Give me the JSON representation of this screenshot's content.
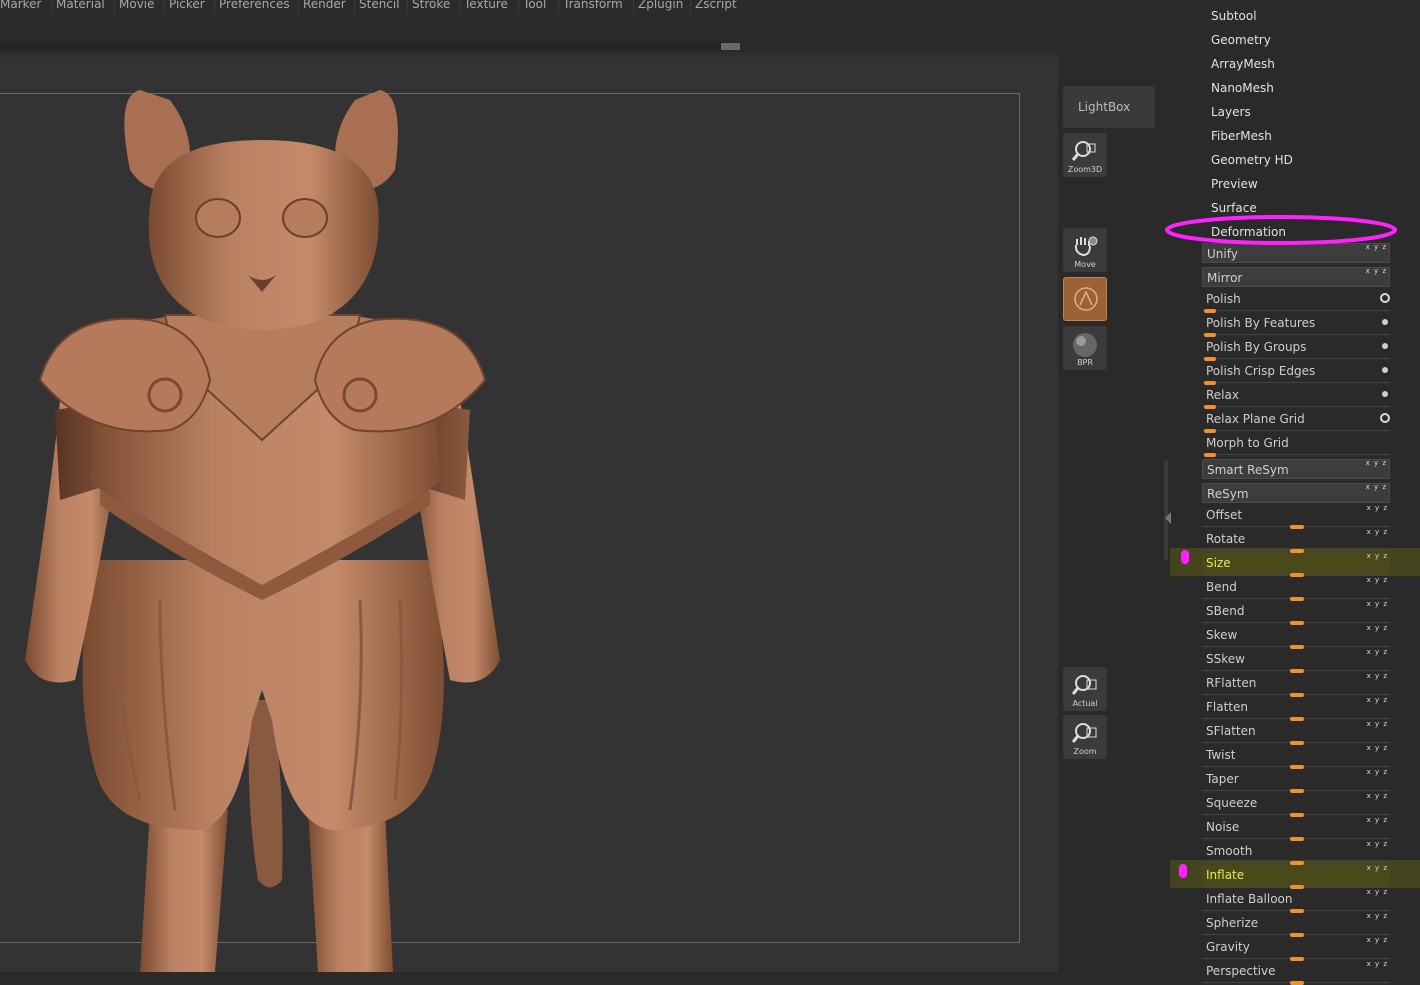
{
  "menu": [
    "Marker",
    "Material",
    "Movie",
    "Picker",
    "Preferences",
    "Render",
    "Stencil",
    "Stroke",
    "Texture",
    "Tool",
    "Transform",
    "Zplugin",
    "Zscript"
  ],
  "lightbox_label": "LightBox",
  "tools": {
    "zoom3d": "Zoom3D",
    "move": "Move",
    "bpr": "BPR",
    "actual": "Actual",
    "zoom": "Zoom"
  },
  "subpalettes": [
    "Subtool",
    "Geometry",
    "ArrayMesh",
    "NanoMesh",
    "Layers",
    "FiberMesh",
    "Geometry HD",
    "Preview",
    "Surface",
    "Deformation"
  ],
  "deformation_rows": [
    "Unify",
    "Mirror",
    "Polish",
    "Polish By Features",
    "Polish By Groups",
    "Polish Crisp Edges",
    "Relax",
    "Relax Plane Grid",
    "Morph to Grid",
    "Smart ReSym",
    "ReSym",
    "Offset",
    "Rotate",
    "Size",
    "Bend",
    "SBend",
    "Skew",
    "SSkew",
    "RFlatten",
    "Flatten",
    "SFlatten",
    "Twist",
    "Taper",
    "Squeeze",
    "Noise",
    "Smooth",
    "Inflate",
    "Inflate Balloon",
    "Spherize",
    "Gravity",
    "Perspective"
  ],
  "axis_label": "x y z",
  "colors": {
    "accent": "#f0922c",
    "annotation": "#ff22ff",
    "highlight": "#e8e85a"
  }
}
